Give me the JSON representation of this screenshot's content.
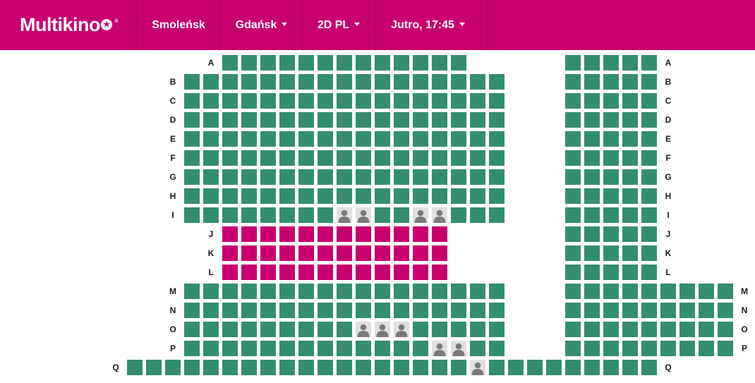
{
  "header": {
    "logo_text": "Multikino",
    "logo_mark": "®",
    "nav": [
      {
        "label": "Smoleńsk",
        "dropdown": false
      },
      {
        "label": "Gdańsk",
        "dropdown": true
      },
      {
        "label": "2D PL",
        "dropdown": true
      },
      {
        "label": "Jutro, 17:45",
        "dropdown": true
      }
    ]
  },
  "colors": {
    "brand": "#c8006e",
    "seat_available": "#358d70",
    "seat_vip": "#c8006e",
    "seat_taken": "#e0e0e0",
    "seat_taken_icon": "#7a7a7a"
  },
  "icons": {
    "taken_seat": "person-icon",
    "logo_star": "star-icon"
  },
  "legend_note": "",
  "rows": [
    {
      "label": "A",
      "show_left": true,
      "show_right": true,
      "blocks": [
        {
          "start": 0,
          "count": 13,
          "type": "available"
        },
        {
          "start": 18,
          "count": 5,
          "type": "available"
        }
      ]
    },
    {
      "label": "B",
      "show_left": true,
      "show_right": true,
      "blocks": [
        {
          "start": -2,
          "count": 17,
          "type": "available"
        },
        {
          "start": 18,
          "count": 5,
          "type": "available"
        }
      ]
    },
    {
      "label": "C",
      "show_left": true,
      "show_right": true,
      "blocks": [
        {
          "start": -2,
          "count": 17,
          "type": "available"
        },
        {
          "start": 18,
          "count": 5,
          "type": "available"
        }
      ]
    },
    {
      "label": "D",
      "show_left": true,
      "show_right": true,
      "blocks": [
        {
          "start": -2,
          "count": 17,
          "type": "available"
        },
        {
          "start": 18,
          "count": 5,
          "type": "available"
        }
      ]
    },
    {
      "label": "E",
      "show_left": true,
      "show_right": true,
      "blocks": [
        {
          "start": -2,
          "count": 17,
          "type": "available"
        },
        {
          "start": 18,
          "count": 5,
          "type": "available"
        }
      ]
    },
    {
      "label": "F",
      "show_left": true,
      "show_right": true,
      "blocks": [
        {
          "start": -2,
          "count": 17,
          "type": "available"
        },
        {
          "start": 18,
          "count": 5,
          "type": "available"
        }
      ]
    },
    {
      "label": "G",
      "show_left": true,
      "show_right": true,
      "blocks": [
        {
          "start": -2,
          "count": 17,
          "type": "available"
        },
        {
          "start": 18,
          "count": 5,
          "type": "available"
        }
      ]
    },
    {
      "label": "H",
      "show_left": true,
      "show_right": true,
      "blocks": [
        {
          "start": -2,
          "count": 17,
          "type": "available"
        },
        {
          "start": 18,
          "count": 5,
          "type": "available"
        }
      ]
    },
    {
      "label": "I",
      "show_left": true,
      "show_right": true,
      "blocks": [
        {
          "start": -2,
          "count": 17,
          "type": "available",
          "taken": [
            8,
            9,
            12,
            13
          ]
        },
        {
          "start": 18,
          "count": 5,
          "type": "available"
        }
      ]
    },
    {
      "label": "J",
      "show_left": true,
      "show_right": true,
      "blocks": [
        {
          "start": 0,
          "count": 12,
          "type": "vip"
        },
        {
          "start": 18,
          "count": 5,
          "type": "available"
        }
      ]
    },
    {
      "label": "K",
      "show_left": true,
      "show_right": true,
      "blocks": [
        {
          "start": 0,
          "count": 12,
          "type": "vip"
        },
        {
          "start": 18,
          "count": 5,
          "type": "available"
        }
      ]
    },
    {
      "label": "L",
      "show_left": true,
      "show_right": true,
      "blocks": [
        {
          "start": 0,
          "count": 12,
          "type": "vip"
        },
        {
          "start": 18,
          "count": 5,
          "type": "available"
        }
      ]
    },
    {
      "label": "M",
      "show_left": true,
      "show_right": true,
      "blocks": [
        {
          "start": -2,
          "count": 17,
          "type": "available"
        },
        {
          "start": 18,
          "count": 9,
          "type": "available"
        }
      ]
    },
    {
      "label": "N",
      "show_left": true,
      "show_right": true,
      "blocks": [
        {
          "start": -2,
          "count": 17,
          "type": "available"
        },
        {
          "start": 18,
          "count": 9,
          "type": "available"
        }
      ]
    },
    {
      "label": "O",
      "show_left": true,
      "show_right": true,
      "blocks": [
        {
          "start": -2,
          "count": 17,
          "type": "available",
          "taken": [
            9,
            10,
            11
          ]
        },
        {
          "start": 18,
          "count": 9,
          "type": "available"
        }
      ]
    },
    {
      "label": "P",
      "show_left": true,
      "show_right": true,
      "blocks": [
        {
          "start": -2,
          "count": 17,
          "type": "available",
          "taken": [
            13,
            14
          ]
        },
        {
          "start": 18,
          "count": 9,
          "type": "available"
        }
      ]
    },
    {
      "label": "Q",
      "show_left": true,
      "show_right": true,
      "blocks": [
        {
          "start": -5,
          "count": 28,
          "type": "available",
          "taken": [
            18
          ]
        }
      ]
    }
  ]
}
